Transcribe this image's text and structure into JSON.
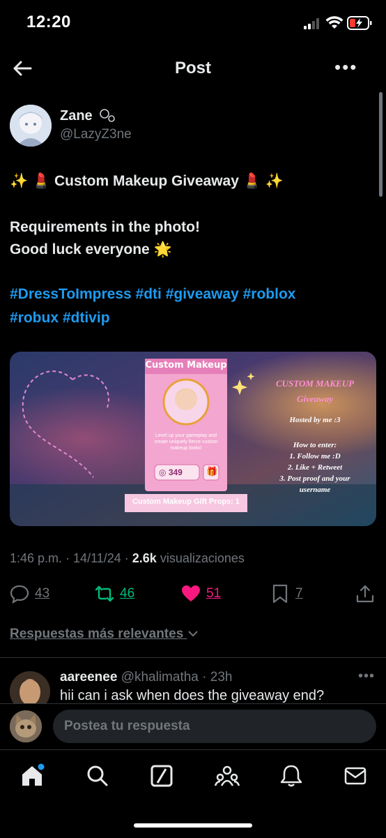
{
  "status_bar": {
    "time": "12:20"
  },
  "header": {
    "title": "Post",
    "more": "•••"
  },
  "author": {
    "name": "Zane",
    "handle": "@LazyZ3ne"
  },
  "post": {
    "line1": "✨ 💄 Custom Makeup Giveaway 💄 ✨",
    "line2": "Requirements in the photo!",
    "line3": "Good luck everyone 🌟",
    "hashtags1": "#DressToImpress #dti #giveaway #roblox",
    "hashtags2": "#robux #dtivip"
  },
  "media": {
    "card_title": "Custom Makeup",
    "card_desc": "Level up your gameplay and create uniquely fierce custom makeup looks!",
    "card_price": "349",
    "card_caption": "Custom Makeup Gift Props: 1",
    "title": "CUSTOM MAKEUP",
    "subtitle": "Giveaway",
    "hosted": "Hosted by me :3",
    "how_to": "How to enter:",
    "step1": "1. Follow me :D",
    "step2": "2. Like + Retweet",
    "step3": "3. Post proof and your",
    "step3b": "username"
  },
  "meta": {
    "time": "1:46 p.m.",
    "date": "14/11/24",
    "views": "2.6k",
    "views_label": "visualizaciones"
  },
  "actions": {
    "replies": "43",
    "reposts": "46",
    "likes": "51",
    "bookmarks": "7"
  },
  "sort_label": "Respuestas más relevantes",
  "reply": {
    "name": "aareenee",
    "handle": "@khalimatha",
    "time": "23h",
    "text": "hii can i ask when does the giveaway end?"
  },
  "compose": {
    "placeholder": "Postea tu respuesta"
  },
  "colors": {
    "accent": "#1d9bf0",
    "repost": "#00ba7c",
    "like": "#f91880",
    "muted": "#71767b"
  }
}
